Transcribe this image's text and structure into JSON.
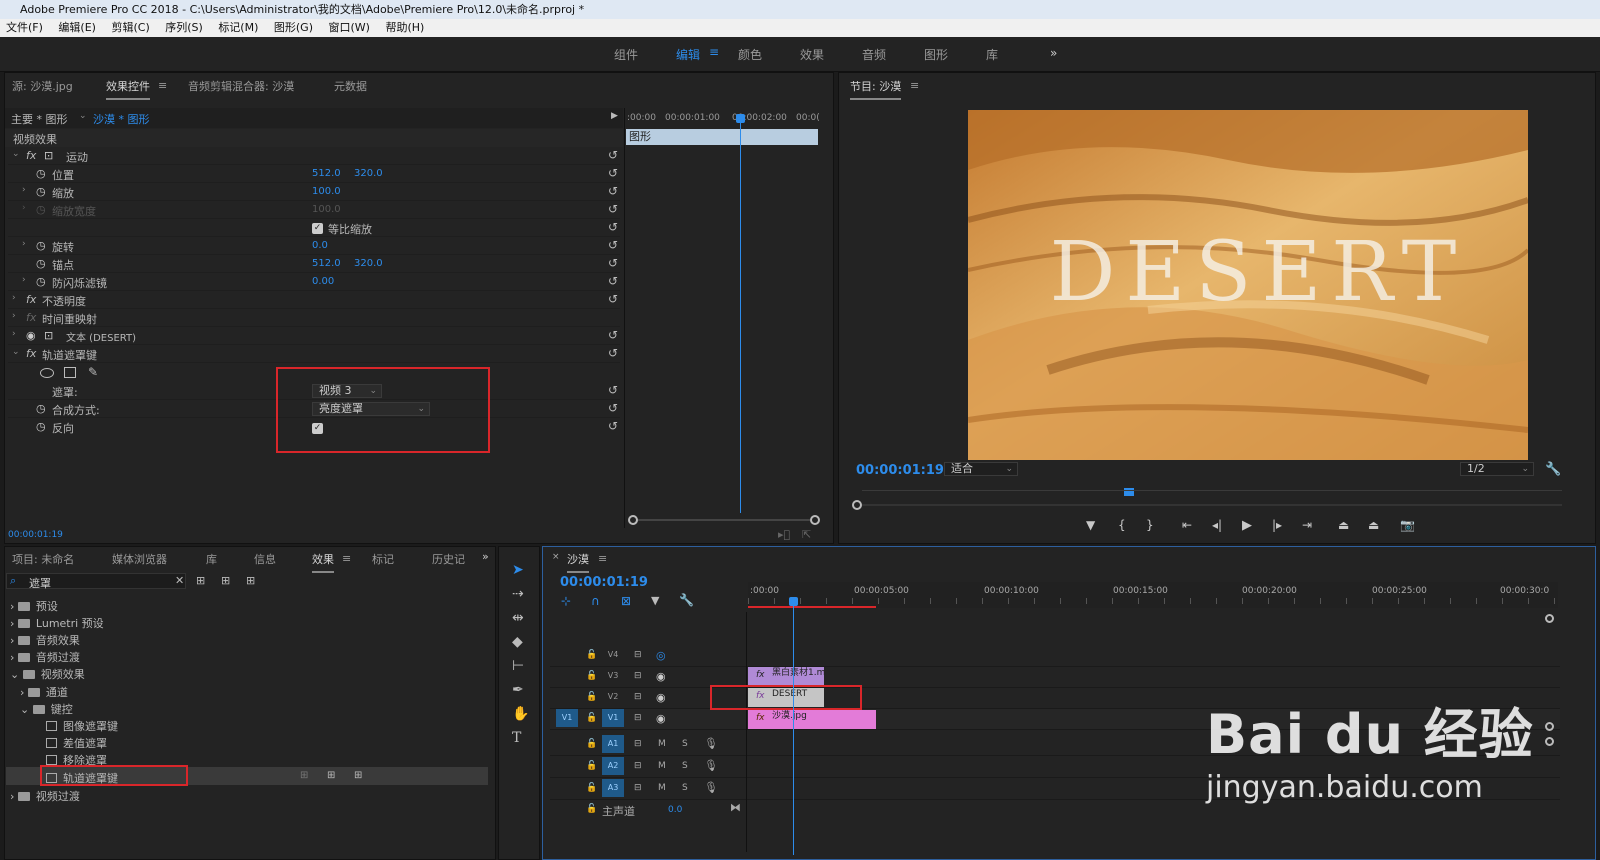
{
  "window": {
    "app_icon": "Pr",
    "title": "Adobe Premiere Pro CC 2018 - C:\\Users\\Administrator\\我的文档\\Adobe\\Premiere Pro\\12.0\\未命名.prproj *"
  },
  "menu": [
    "文件(F)",
    "编辑(E)",
    "剪辑(C)",
    "序列(S)",
    "标记(M)",
    "图形(G)",
    "窗口(W)",
    "帮助(H)"
  ],
  "workspaces": {
    "tabs": [
      "组件",
      "编辑",
      "颜色",
      "效果",
      "音频",
      "图形",
      "库"
    ],
    "active_index": 1,
    "more": "»"
  },
  "effect_controls": {
    "tabs": [
      "源: 沙漠.jpg",
      "效果控件",
      "音频剪辑混合器: 沙漠",
      "元数据"
    ],
    "active_tab": 1,
    "master": "主要 * 图形",
    "clip": "沙漠 * 图形",
    "section": "视频效果",
    "timeline_times": [
      ":00:00",
      "00:00:01:00",
      "00:00:02:00",
      "00:0("
    ],
    "clip_bar": "图形",
    "rows": [
      {
        "label": "运动",
        "type": "group"
      },
      {
        "label": "位置",
        "v1": "512.0",
        "v2": "320.0"
      },
      {
        "label": "缩放",
        "v1": "100.0"
      },
      {
        "label": "缩放宽度",
        "v1": "100.0",
        "disabled": true
      },
      {
        "label": "等比缩放",
        "type": "checkbox"
      },
      {
        "label": "旋转",
        "v1": "0.0"
      },
      {
        "label": "锚点",
        "v1": "512.0",
        "v2": "320.0"
      },
      {
        "label": "防闪烁滤镜",
        "v1": "0.00"
      },
      {
        "label": "不透明度",
        "type": "group"
      },
      {
        "label": "时间重映射",
        "type": "group"
      },
      {
        "label": "文本 (DESERT)",
        "type": "group"
      },
      {
        "label": "轨道遮罩键",
        "type": "group"
      }
    ],
    "mask_label": "遮罩:",
    "mask_value": "视频 3",
    "composite_label": "合成方式:",
    "composite_value": "亮度遮罩",
    "reverse_label": "反向",
    "timecode": "00:00:01:19"
  },
  "program": {
    "title": "节目: 沙漠",
    "image_text": "DESERT",
    "timecode": "00:00:01:19",
    "fit": "适合",
    "resolution": "1/2"
  },
  "project": {
    "tabs": [
      "项目: 未命名",
      "媒体浏览器",
      "库",
      "信息",
      "效果",
      "标记",
      "历史记"
    ],
    "active_tab": 4,
    "search_value": "遮罩",
    "tree": [
      {
        "label": "预设",
        "level": 0,
        "kind": "folder"
      },
      {
        "label": "Lumetri 预设",
        "level": 0,
        "kind": "folder"
      },
      {
        "label": "音频效果",
        "level": 0,
        "kind": "folder"
      },
      {
        "label": "音频过渡",
        "level": 0,
        "kind": "folder"
      },
      {
        "label": "视频效果",
        "level": 0,
        "kind": "folder",
        "open": true
      },
      {
        "label": "通道",
        "level": 1,
        "kind": "folder"
      },
      {
        "label": "键控",
        "level": 1,
        "kind": "folder",
        "open": true
      },
      {
        "label": "图像遮罩键",
        "level": 2,
        "kind": "fx"
      },
      {
        "label": "差值遮罩",
        "level": 2,
        "kind": "fx"
      },
      {
        "label": "移除遮罩",
        "level": 2,
        "kind": "fx"
      },
      {
        "label": "轨道遮罩键",
        "level": 2,
        "kind": "fx",
        "selected": true
      },
      {
        "label": "视频过渡",
        "level": 0,
        "kind": "folder"
      }
    ]
  },
  "timeline": {
    "title": "沙漠",
    "timecode": "00:00:01:19",
    "ruler": [
      ":00:00",
      "00:00:05:00",
      "00:00:10:00",
      "00:00:15:00",
      "00:00:20:00",
      "00:00:25:00",
      "00:00:30:0"
    ],
    "tracks": [
      "V4",
      "V3",
      "V2",
      "V1",
      "A1",
      "A2",
      "A3"
    ],
    "source_patch": "V1",
    "master": "主声道",
    "master_value": "0.0",
    "clips": [
      {
        "track": "V3",
        "label": "黑白素材1.m",
        "color": "#b08ad6"
      },
      {
        "track": "V2",
        "label": "DESERT",
        "color": "#c5c5c5"
      },
      {
        "track": "V1",
        "label": "沙漠.jpg",
        "color": "#e37bd8"
      }
    ],
    "mute": "M",
    "solo": "S"
  },
  "watermark": {
    "brand": "Bai du 经验",
    "url": "jingyan.baidu.com"
  }
}
